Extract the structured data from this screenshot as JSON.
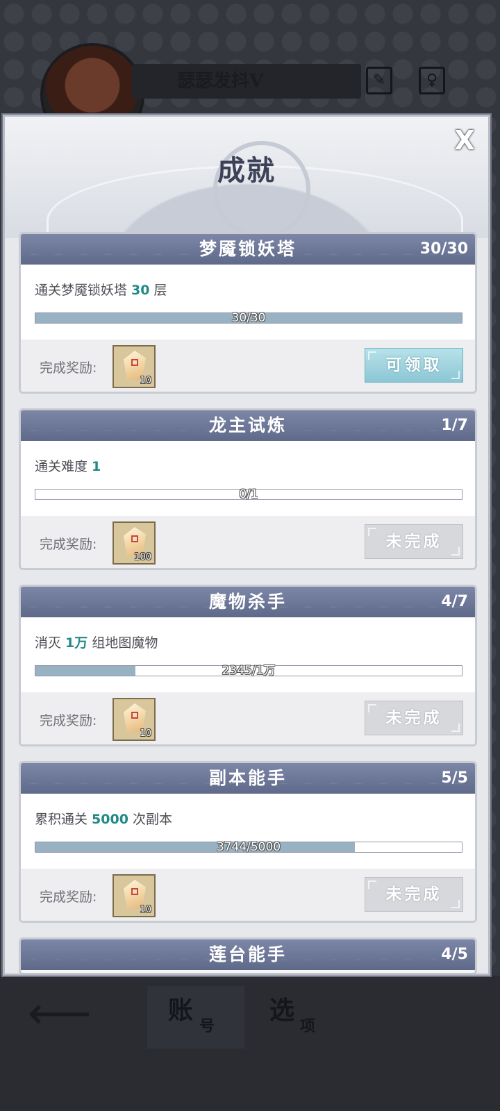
{
  "background": {
    "player_name": "瑟瑟发抖V",
    "edit_icon": "brush-icon",
    "gender_icon": "female-icon",
    "back_icon": "back-arrow-icon",
    "tabs": [
      {
        "main": "账",
        "sub": "号"
      },
      {
        "main": "选",
        "sub": "项"
      }
    ]
  },
  "modal": {
    "title": "成就",
    "close_label": "X",
    "reward_label": "完成奖励:",
    "items": [
      {
        "title": "梦魇锁妖塔",
        "count": "30/30",
        "desc_prefix": "通关梦魇锁妖塔 ",
        "desc_value": "30",
        "desc_suffix": " 层",
        "progress_text": "30/30",
        "progress": 1.0,
        "reward_qty": "10",
        "button": "可领取",
        "state": "claim"
      },
      {
        "title": "龙主试炼",
        "count": "1/7",
        "desc_prefix": "通关难度 ",
        "desc_value": "1",
        "desc_suffix": "",
        "progress_text": "0/1",
        "progress": 0.0,
        "reward_qty": "100",
        "button": "未完成",
        "state": "incomplete"
      },
      {
        "title": "魔物杀手",
        "count": "4/7",
        "desc_prefix": "消灭 ",
        "desc_value": "1万",
        "desc_suffix": " 组地图魔物",
        "progress_text": "2345/1万",
        "progress": 0.2345,
        "reward_qty": "10",
        "button": "未完成",
        "state": "incomplete"
      },
      {
        "title": "副本能手",
        "count": "5/5",
        "desc_prefix": "累积通关 ",
        "desc_value": "5000",
        "desc_suffix": " 次副本",
        "progress_text": "3744/5000",
        "progress": 0.7488,
        "reward_qty": "10",
        "button": "未完成",
        "state": "incomplete"
      },
      {
        "title": "莲台能手",
        "count": "4/5"
      }
    ]
  }
}
